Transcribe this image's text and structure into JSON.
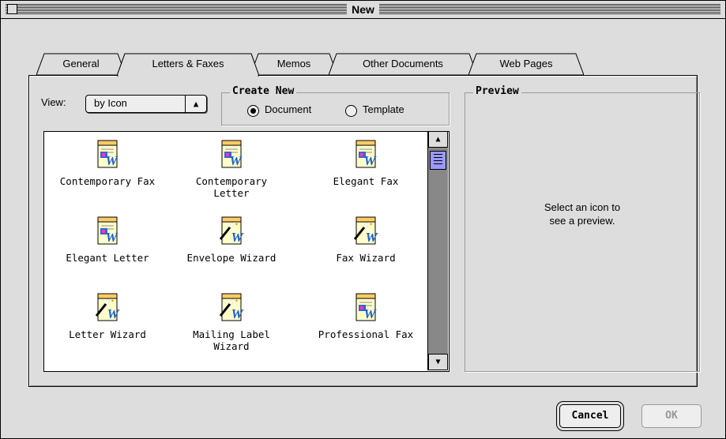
{
  "window": {
    "title": "New"
  },
  "tabs": [
    {
      "label": "General"
    },
    {
      "label": "Letters & Faxes"
    },
    {
      "label": "Memos"
    },
    {
      "label": "Other Documents"
    },
    {
      "label": "Web Pages"
    }
  ],
  "active_tab": "Letters & Faxes",
  "view": {
    "label": "View:",
    "selected": "by Icon"
  },
  "create_new": {
    "title": "Create New",
    "options": [
      {
        "label": "Document",
        "selected": true
      },
      {
        "label": "Template",
        "selected": false
      }
    ]
  },
  "templates": [
    {
      "label": "Contemporary Fax",
      "icon": "word-document-icon"
    },
    {
      "label": "Contemporary Letter",
      "icon": "word-document-icon"
    },
    {
      "label": "Elegant Fax",
      "icon": "word-document-icon"
    },
    {
      "label": "Elegant Letter",
      "icon": "word-document-icon"
    },
    {
      "label": "Envelope Wizard",
      "icon": "word-wizard-icon"
    },
    {
      "label": "Fax Wizard",
      "icon": "word-wizard-icon"
    },
    {
      "label": "Letter Wizard",
      "icon": "word-wizard-icon"
    },
    {
      "label": "Mailing Label Wizard",
      "icon": "word-wizard-icon"
    },
    {
      "label": "Professional Fax",
      "icon": "word-document-icon"
    }
  ],
  "preview": {
    "title": "Preview",
    "message": "Select an icon to see a preview."
  },
  "buttons": {
    "cancel": "Cancel",
    "ok": "OK"
  }
}
